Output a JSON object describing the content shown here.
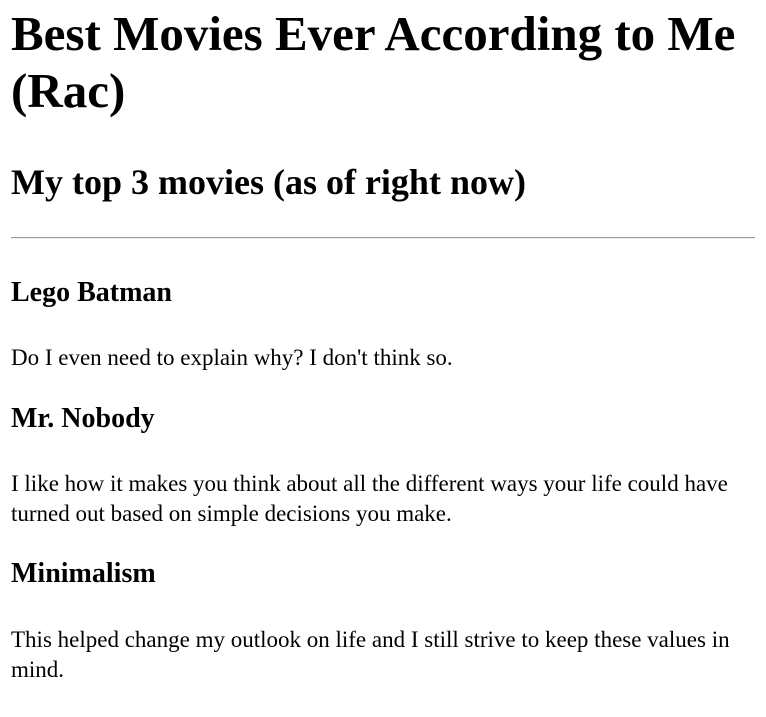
{
  "page": {
    "title": "Best Movies Ever According to Me (Rac)",
    "subtitle": "My top 3 movies (as of right now)"
  },
  "movies": [
    {
      "title": "Lego Batman",
      "description": "Do I even need to explain why? I don't think so."
    },
    {
      "title": "Mr. Nobody",
      "description": "I like how it makes you think about all the different ways your life could have turned out based on simple decisions you make."
    },
    {
      "title": "Minimalism",
      "description": "This helped change my outlook on life and I still strive to keep these values in mind."
    }
  ]
}
